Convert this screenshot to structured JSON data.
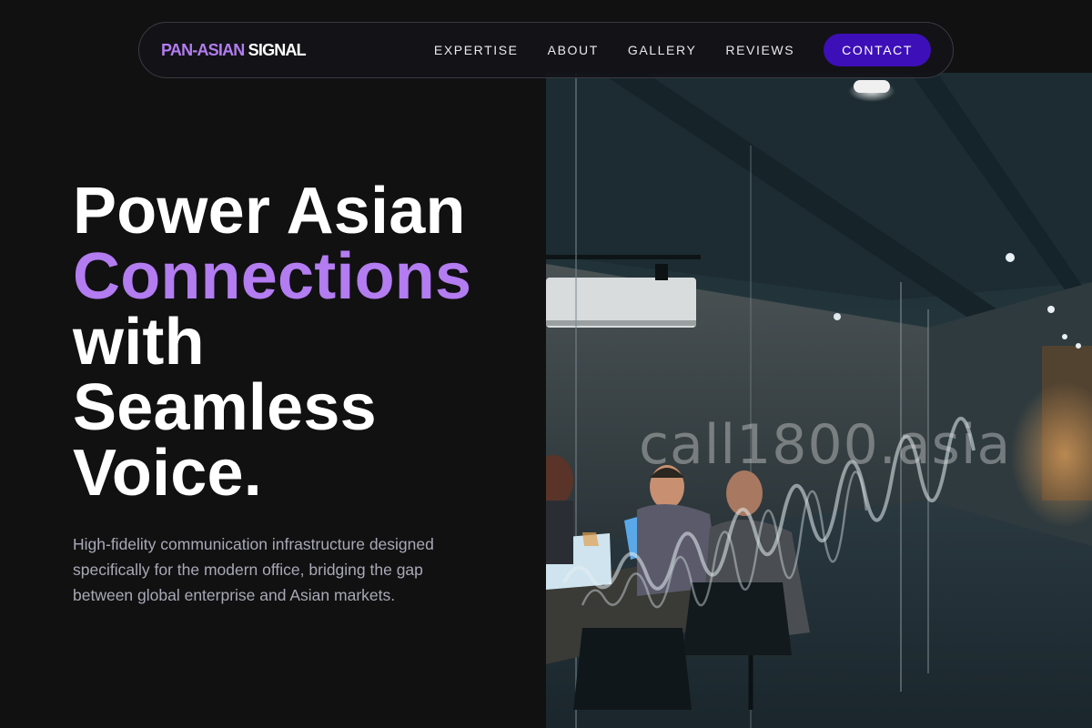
{
  "brand": {
    "part1": "PAN-ASIAN",
    "part2": "SIGNAL"
  },
  "nav": {
    "links": [
      {
        "label": "EXPERTISE"
      },
      {
        "label": "ABOUT"
      },
      {
        "label": "GALLERY"
      },
      {
        "label": "REVIEWS"
      }
    ],
    "cta_label": "CONTACT"
  },
  "hero": {
    "headline_lines": [
      "Power Asian",
      "Connections",
      "with",
      "Seamless",
      "Voice."
    ],
    "subtext": "High-fidelity communication infrastructure designed specifically for the modern office, bridging the gap between global enterprise and Asian markets."
  },
  "image": {
    "wall_text": "call1800.asia"
  },
  "colors": {
    "accent": "#b37cf0",
    "cta_background": "#3d0fb8",
    "page_background": "#111112",
    "body_text": "#a9a9b6"
  }
}
